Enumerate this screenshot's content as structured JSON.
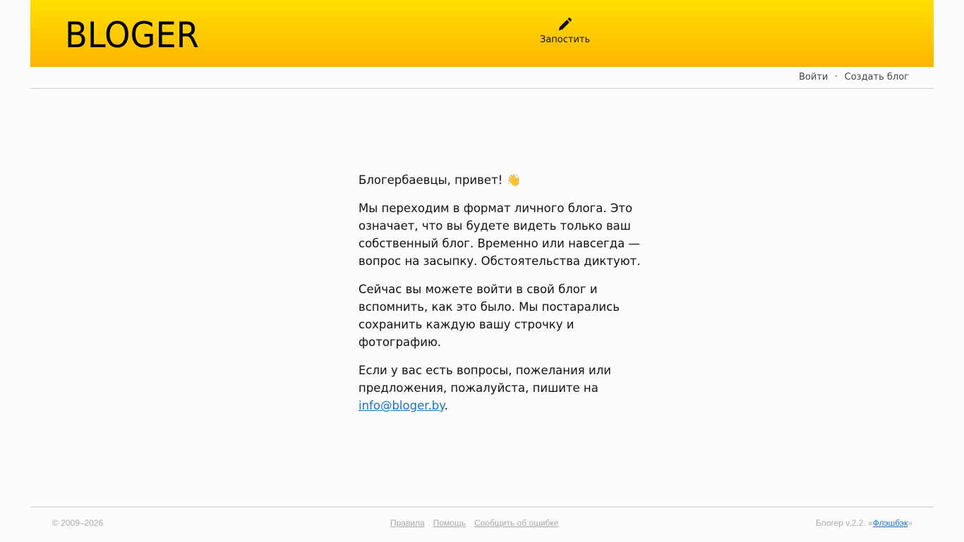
{
  "header": {
    "logo_text": "BLOGER",
    "post_label": "Запостить",
    "gradient_top": "#ffdf00",
    "gradient_bottom": "#ffb300"
  },
  "subnav": {
    "login": "Войти",
    "separator": "•",
    "create_blog": "Создать блог"
  },
  "content": {
    "greeting": "Блогербаевцы, привет!",
    "greeting_emoji": "👋",
    "para1": "Мы переходим в формат личного блога. Это означает, что вы будете видеть только ваш собственный блог. Временно или навсегда — вопрос на засыпку. Обстоятельства диктуют.",
    "para2": "Сейчас вы можете войти в свой блог и вспомнить, как это было. Мы постарались сохранить каждую вашу строчку и фотографию.",
    "para3_prefix": "Если у вас есть вопросы, пожелания или предложения, пожалуйста, пишите на ",
    "email": "info@bloger.by",
    "para3_suffix": "."
  },
  "footer": {
    "copyright": "© 2009–2026",
    "links": [
      "Правила",
      "Помощь",
      "Сообщить об ошибке"
    ],
    "version_prefix": "Блогер v.2.2. «",
    "version_link": "Флэшбэк",
    "version_suffix": "»"
  },
  "colors": {
    "link": "#1a73c9",
    "background": "#fcfcfc"
  },
  "icons": {
    "post": "pencil-icon",
    "logo": "bloger-logo"
  }
}
